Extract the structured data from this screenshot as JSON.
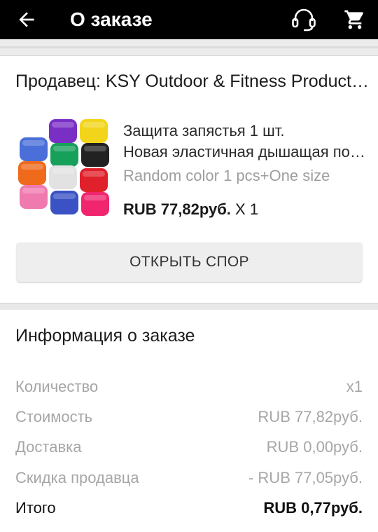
{
  "header": {
    "title": "О заказе",
    "back_icon": "arrow-left-icon",
    "support_icon": "headset-icon",
    "cart_icon": "cart-icon",
    "background": "#000000"
  },
  "seller": {
    "label": "Продавец: KSY Outdoor & Fitness Products Store"
  },
  "product": {
    "name_line1": "Защита запястья 1 шт.",
    "name_line2": "Новая эластичная дышащая повязка на запястье",
    "variant": "Random color 1 pcs+One size",
    "price": "RUB 77,82руб.",
    "quantity": "X 1",
    "image": "colorful-wristbands-thumbnail",
    "swatch_colors": [
      "#7a2fc4",
      "#f2d51a",
      "#4a6fd8",
      "#16a05a",
      "#222222",
      "#f06a1c",
      "#e2e2e2",
      "#e0202a",
      "#f07ab0",
      "#3a52c4",
      "#f0256e"
    ]
  },
  "actions": {
    "open_dispute": "ОТКРЫТЬ СПОР"
  },
  "order_info": {
    "title": "Информация о заказе",
    "rows": [
      {
        "label": "Количество",
        "value": "x1"
      },
      {
        "label": "Стоимость",
        "value": "RUB 77,82руб."
      },
      {
        "label": "Доставка",
        "value": "RUB 0,00руб."
      },
      {
        "label": "Скидка продавца",
        "value": "- RUB 77,05руб."
      }
    ],
    "total": {
      "label": "Итого",
      "value": "RUB 0,77руб."
    }
  }
}
